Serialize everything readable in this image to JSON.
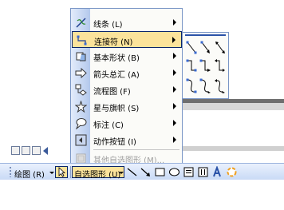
{
  "menu": {
    "items": [
      {
        "label": "线条 (L)",
        "icon": "lines-icon",
        "submenu": true
      },
      {
        "label": "连接符 (N)",
        "icon": "connector-icon",
        "submenu": true,
        "highlighted": true
      },
      {
        "label": "基本形状 (B)",
        "icon": "basic-shapes-icon",
        "submenu": true
      },
      {
        "label": "箭头总汇 (A)",
        "icon": "block-arrows-icon",
        "submenu": true
      },
      {
        "label": "流程图 (F)",
        "icon": "flowchart-icon",
        "submenu": true
      },
      {
        "label": "星与旗帜 (S)",
        "icon": "stars-banners-icon",
        "submenu": true
      },
      {
        "label": "标注 (C)",
        "icon": "callouts-icon",
        "submenu": true
      },
      {
        "label": "动作按钮 (I)",
        "icon": "action-buttons-icon",
        "submenu": true
      },
      {
        "label": "其他自选图形 (M)...",
        "icon": "more-autoshapes-icon",
        "submenu": false,
        "disabled": true
      }
    ]
  },
  "submenu": {
    "icons": [
      "straight-connector-icon",
      "straight-arrow-connector-icon",
      "straight-double-arrow-connector-icon",
      "elbow-connector-icon",
      "elbow-arrow-connector-icon",
      "elbow-double-arrow-connector-icon",
      "curved-connector-icon",
      "curved-arrow-connector-icon",
      "curved-double-arrow-connector-icon"
    ]
  },
  "toolbar": {
    "draw_label": "绘图 (R)",
    "autoshapes_label": "自选图形 (U)"
  },
  "colors": {
    "highlight": "#fbe39b",
    "highlight_border": "#0a246a",
    "menu_border": "#7a96c6",
    "accent_blue": "#2b53a8"
  }
}
